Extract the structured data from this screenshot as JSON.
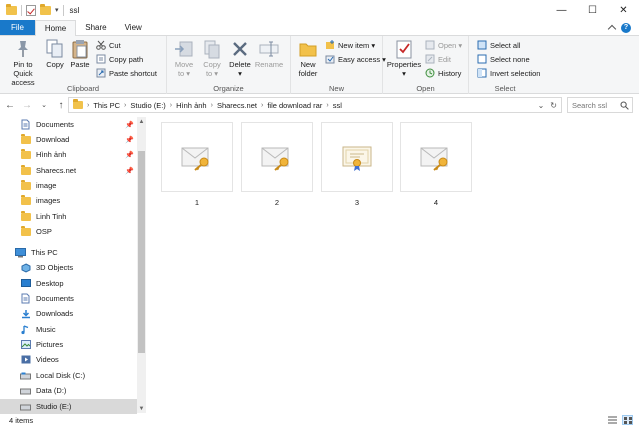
{
  "window": {
    "title": "ssl",
    "controls": {
      "minimize": "—",
      "maximize": "☐",
      "close": "✕"
    }
  },
  "ribbon_tabs": [
    "File",
    "Home",
    "Share",
    "View"
  ],
  "ribbon": {
    "clipboard": {
      "label": "Clipboard",
      "pin": "Pin to Quick\naccess",
      "copy": "Copy",
      "paste": "Paste",
      "cut": "Cut",
      "copy_path": "Copy path",
      "paste_shortcut": "Paste shortcut"
    },
    "organize": {
      "label": "Organize",
      "move_to": "Move\nto ▾",
      "copy_to": "Copy\nto ▾",
      "delete": "Delete\n▾",
      "rename": "Rename"
    },
    "new": {
      "label": "New",
      "new_folder": "New\nfolder",
      "new_item": "New item ▾",
      "easy_access": "Easy access ▾"
    },
    "open": {
      "label": "Open",
      "properties": "Properties\n▾",
      "open": "Open ▾",
      "edit": "Edit",
      "history": "History"
    },
    "select": {
      "label": "Select",
      "select_all": "Select all",
      "select_none": "Select none",
      "invert": "Invert selection"
    }
  },
  "address": {
    "crumbs": [
      "This PC",
      "Studio (E:)",
      "Hình ảnh",
      "Sharecs.net",
      "file download rar",
      "ssl"
    ],
    "search_placeholder": "Search ssl"
  },
  "nav_items": [
    {
      "label": "Documents",
      "icon": "documents-icon",
      "pinned": true
    },
    {
      "label": "Download",
      "icon": "folder-icon",
      "pinned": true
    },
    {
      "label": "Hình ảnh",
      "icon": "folder-icon",
      "pinned": true
    },
    {
      "label": "Sharecs.net",
      "icon": "folder-icon",
      "pinned": true
    },
    {
      "label": "image",
      "icon": "folder-icon",
      "pinned": false
    },
    {
      "label": "images",
      "icon": "folder-icon",
      "pinned": false
    },
    {
      "label": "Linh Tinh",
      "icon": "folder-icon",
      "pinned": false
    },
    {
      "label": "OSP",
      "icon": "folder-icon",
      "pinned": false
    },
    {
      "label": "This PC",
      "icon": "this-pc-icon",
      "pinned": false
    },
    {
      "label": "3D Objects",
      "icon": "3d-objects-icon",
      "pinned": false
    },
    {
      "label": "Desktop",
      "icon": "desktop-icon",
      "pinned": false
    },
    {
      "label": "Documents",
      "icon": "documents-icon",
      "pinned": false
    },
    {
      "label": "Downloads",
      "icon": "downloads-icon",
      "pinned": false
    },
    {
      "label": "Music",
      "icon": "music-icon",
      "pinned": false
    },
    {
      "label": "Pictures",
      "icon": "pictures-icon",
      "pinned": false
    },
    {
      "label": "Videos",
      "icon": "videos-icon",
      "pinned": false
    },
    {
      "label": "Local Disk (C:)",
      "icon": "drive-icon",
      "pinned": false
    },
    {
      "label": "Data (D:)",
      "icon": "drive-icon",
      "pinned": false
    },
    {
      "label": "Studio (E:)",
      "icon": "drive-icon",
      "pinned": false,
      "selected": true
    }
  ],
  "files": [
    {
      "name": "1",
      "icon": "certificate-envelope-icon"
    },
    {
      "name": "2",
      "icon": "certificate-envelope-icon"
    },
    {
      "name": "3",
      "icon": "certificate-icon"
    },
    {
      "name": "4",
      "icon": "certificate-envelope-icon"
    }
  ],
  "status": {
    "item_count": "4 items"
  },
  "colors": {
    "accent": "#1979ca",
    "folder": "#f2c14a",
    "selected_nav": "#d9d9d9"
  }
}
